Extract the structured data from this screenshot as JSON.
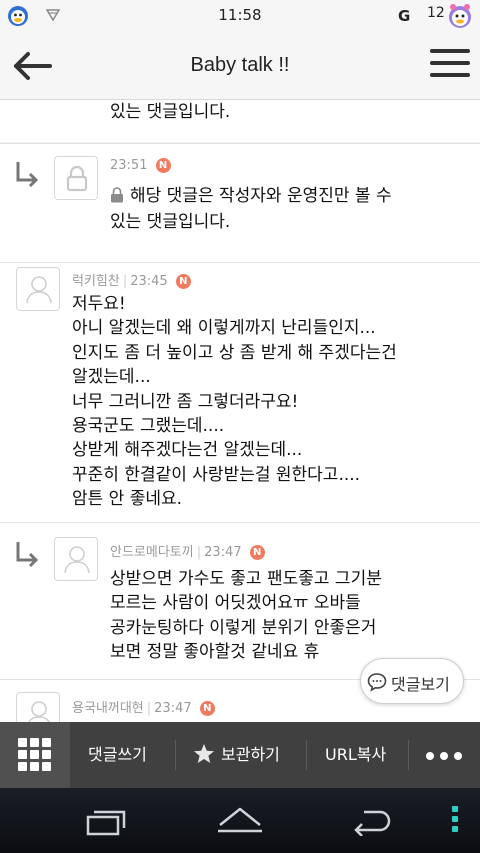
{
  "status_bar": {
    "time": "11:58",
    "network": "G",
    "count": "12"
  },
  "header": {
    "title": "Baby talk !!",
    "back_icon": "arrow-left-icon",
    "menu_icon": "hamburger-icon"
  },
  "comments": [
    {
      "type": "partial",
      "body": "있는 댓글입니다."
    },
    {
      "type": "reply",
      "author": "",
      "time": "23:51",
      "badge": "N",
      "private": true,
      "body_line1": "해당 댓글은 작성자와 운영진만 볼 수",
      "body_line2": "있는 댓글입니다."
    },
    {
      "type": "comment",
      "author": "럭키힘찬",
      "time": "23:45",
      "badge": "N",
      "lines": [
        "저두요!",
        "아니 알겠는데 왜 이렇게까지 난리들인지...",
        "인지도 좀 더 높이고 상 좀 받게 해 주겠다는건",
        "알겠는데...",
        "너무 그러니깐 좀 그렇더라구요!",
        "용국군도 그랬는데....",
        "상받게 해주겠다는건 알겠는데...",
        "꾸준히 한결같이 사랑받는걸 원한다고....",
        "암튼 안 좋네요."
      ]
    },
    {
      "type": "reply",
      "author": "안드로메다토끼",
      "time": "23:47",
      "badge": "N",
      "lines": [
        "상받으면 가수도 좋고 팬도좋고 그기분",
        "모르는 사람이 어딧겠어요ㅠ 오바들",
        "공카눈팅하다 이렇게 분위기 안좋은거",
        "보면 정말 좋아할것 같네요 휴"
      ]
    },
    {
      "type": "comment",
      "author": "용국내꺼대현",
      "time": "23:47",
      "badge": "N"
    }
  ],
  "floating_button": {
    "label": "댓글보기",
    "icon": "speech-bubble-icon"
  },
  "toolbar": {
    "grid_icon": "grid-menu-icon",
    "write_label": "댓글쓰기",
    "save_label": "보관하기",
    "save_icon": "star-icon",
    "url_label": "URL복사",
    "more_icon": "more-dots-icon"
  },
  "colors": {
    "badge": "#f17a5e",
    "toolbar_bg": "#404040",
    "nav_accent": "#2bd0c7"
  }
}
